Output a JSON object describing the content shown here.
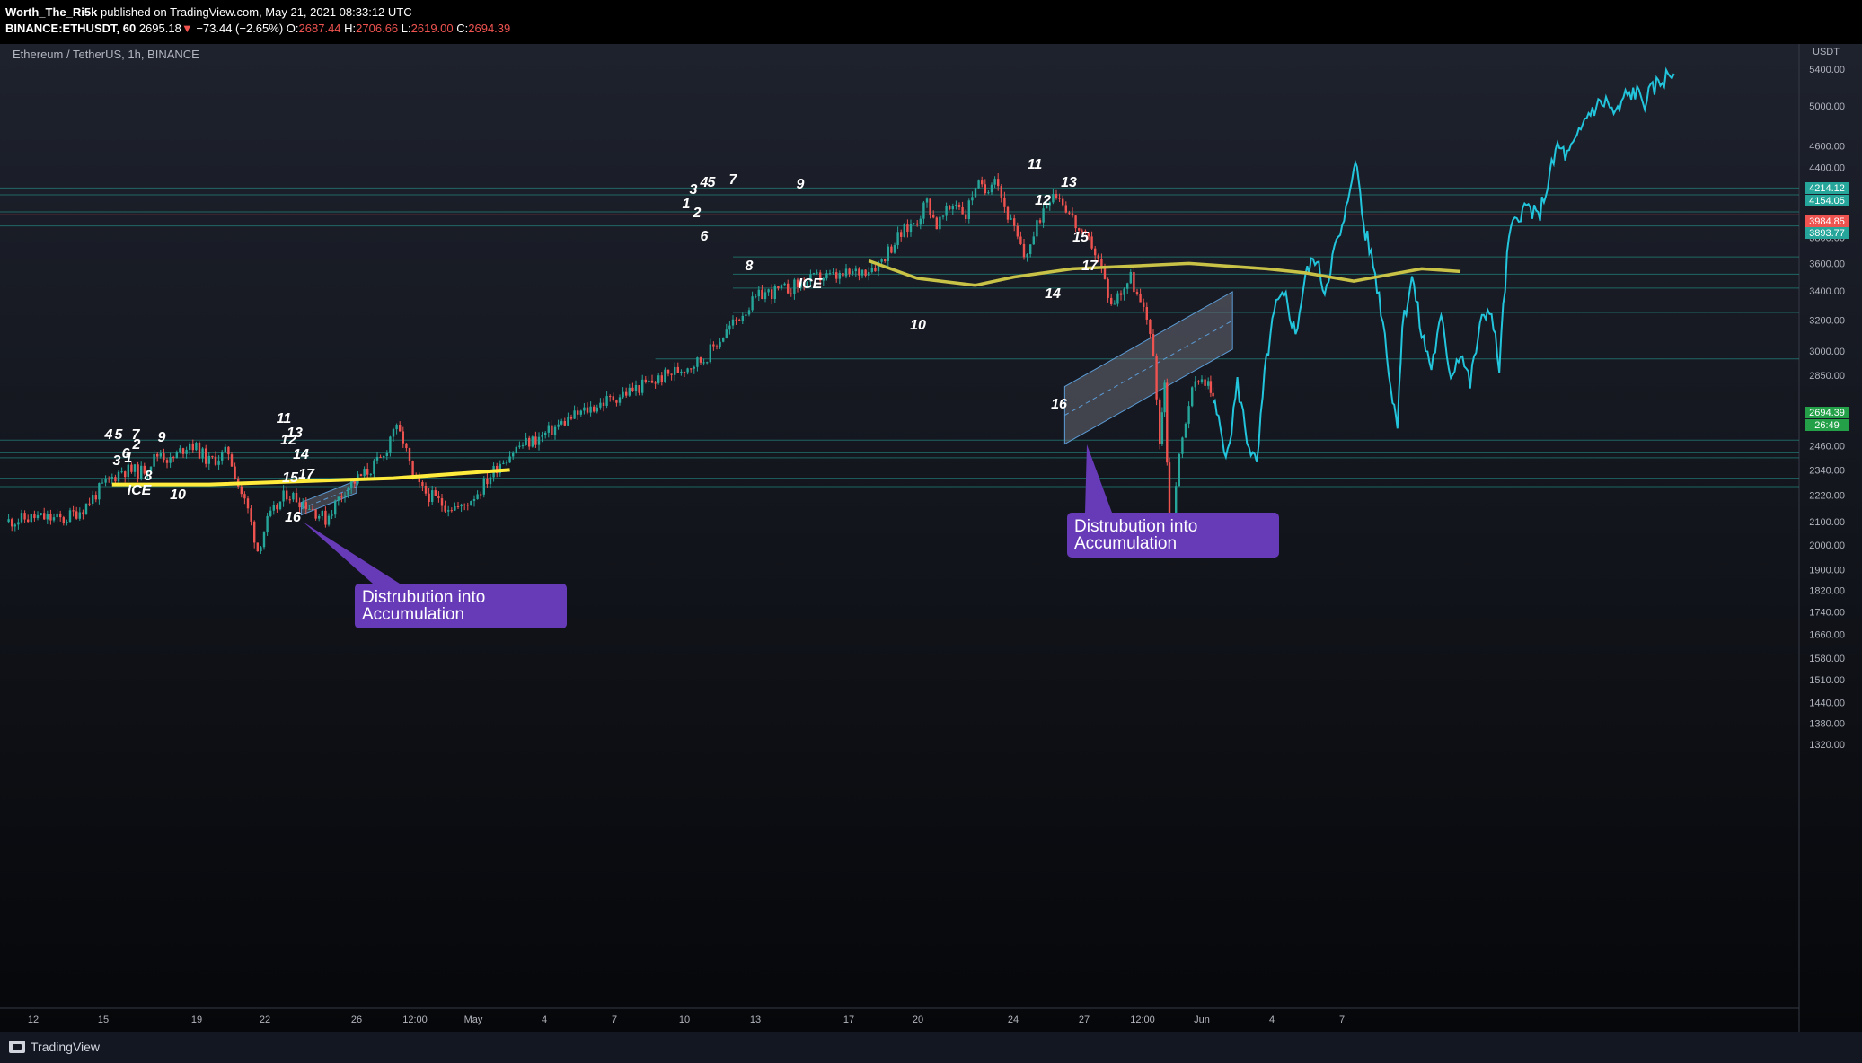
{
  "header": {
    "author": "Worth_The_Ri5k",
    "published_text": "published on TradingView.com, May 21, 2021 08:33:12 UTC",
    "symbol": "BINANCE:ETHUSDT, 60",
    "last": "2695.18",
    "arrow": "▼",
    "change": "−73.44 (−2.65%)",
    "open_label": "O:",
    "open": "2687.44",
    "high_label": "H:",
    "high": "2706.66",
    "low_label": "L:",
    "low": "2619.00",
    "close_label": "C:",
    "close": "2694.39"
  },
  "chart_title": "Ethereum / TetherUS, 1h, BINANCE",
  "footer": {
    "brand": "TradingView"
  },
  "colors": {
    "background": "#131722",
    "up": "#26a69a",
    "down": "#ef5350",
    "projection": "#22c5dc",
    "ice_line": "#e8e36a",
    "callout": "#673ab7",
    "price_tag": "#24a148"
  },
  "chart_data": {
    "type": "candlestick",
    "title": "Ethereum / TetherUS, 1h, BINANCE",
    "y_axis": {
      "unit": "USDT",
      "scale": "log",
      "ticks": [
        1320,
        1380,
        1440,
        1510,
        1580,
        1660,
        1740,
        1820,
        1900,
        2000,
        2100,
        2220,
        2340,
        2460,
        2580,
        2850,
        3000,
        3200,
        3400,
        3600,
        3800,
        4400,
        4600,
        5000,
        5400
      ],
      "tick_labels": [
        "1320.00",
        "1380.00",
        "1440.00",
        "1510.00",
        "1580.00",
        "1660.00",
        "1740.00",
        "1820.00",
        "1900.00",
        "2000.00",
        "2100.00",
        "2220.00",
        "2340.00",
        "2460.00",
        "2580.00",
        "2850.00",
        "3000.00",
        "3200.00",
        "3400.00",
        "3600.00",
        "3800.00",
        "4400.00",
        "4600.00",
        "5000.00",
        "5400.00"
      ]
    },
    "x_axis": {
      "tick_labels": [
        "12",
        "15",
        "19",
        "22",
        "26",
        "12:00",
        "May",
        "4",
        "7",
        "10",
        "13",
        "17",
        "20",
        "24",
        "27",
        "12:00",
        "Jun",
        "4",
        "7"
      ]
    },
    "price_tags": [
      {
        "value": "4214.12",
        "color": "#26a69a"
      },
      {
        "value": "4154.05",
        "color": "#26a69a"
      },
      {
        "value": "3984.85",
        "color": "#ef5350"
      },
      {
        "value": "3893.77",
        "color": "#26a69a"
      },
      {
        "value": "2694.39",
        "color": "#24a148"
      },
      {
        "value": "26:49",
        "color": "#24a148"
      }
    ],
    "series": [
      {
        "style": "candles",
        "points": [
          [
            0,
            2100
          ],
          [
            3,
            2120
          ],
          [
            6,
            2110
          ],
          [
            8,
            2160
          ],
          [
            10,
            2260
          ],
          [
            12,
            2340
          ],
          [
            14,
            2330
          ],
          [
            16,
            2430
          ],
          [
            17,
            2380
          ],
          [
            19,
            2480
          ],
          [
            21,
            2380
          ],
          [
            23,
            2430
          ],
          [
            24,
            2270
          ],
          [
            25,
            2150
          ],
          [
            26,
            1980
          ],
          [
            27,
            2100
          ],
          [
            29,
            2230
          ],
          [
            31,
            2180
          ],
          [
            33,
            2110
          ],
          [
            35,
            2250
          ],
          [
            37,
            2320
          ],
          [
            39,
            2400
          ],
          [
            40,
            2560
          ],
          [
            41,
            2490
          ],
          [
            42,
            2300
          ],
          [
            43,
            2240
          ],
          [
            45,
            2180
          ],
          [
            47,
            2160
          ],
          [
            49,
            2250
          ],
          [
            51,
            2380
          ],
          [
            53,
            2460
          ],
          [
            55,
            2500
          ],
          [
            58,
            2600
          ],
          [
            61,
            2680
          ],
          [
            64,
            2750
          ],
          [
            67,
            2820
          ],
          [
            70,
            2900
          ],
          [
            72,
            2950
          ],
          [
            74,
            3100
          ],
          [
            76,
            3250
          ],
          [
            78,
            3380
          ],
          [
            80,
            3400
          ],
          [
            82,
            3450
          ],
          [
            84,
            3500
          ],
          [
            86,
            3500
          ],
          [
            88,
            3540
          ],
          [
            90,
            3600
          ],
          [
            92,
            3800
          ],
          [
            94,
            3950
          ],
          [
            95,
            4100
          ],
          [
            96,
            3900
          ],
          [
            98,
            4100
          ],
          [
            99,
            3980
          ],
          [
            100,
            4250
          ],
          [
            101,
            4180
          ],
          [
            102,
            4350
          ],
          [
            103,
            4050
          ],
          [
            104,
            3850
          ],
          [
            105,
            3650
          ],
          [
            106,
            3800
          ],
          [
            107,
            4050
          ],
          [
            108,
            4200
          ],
          [
            109,
            4100
          ],
          [
            110,
            3950
          ],
          [
            111,
            3800
          ],
          [
            112,
            3750
          ],
          [
            113,
            3550
          ],
          [
            114,
            3300
          ],
          [
            115,
            3400
          ],
          [
            116,
            3500
          ],
          [
            117,
            3300
          ],
          [
            118,
            3150
          ],
          [
            119,
            2500
          ],
          [
            119.5,
            2800
          ],
          [
            120,
            2000
          ],
          [
            121,
            2400
          ],
          [
            122,
            2700
          ],
          [
            123,
            2850
          ],
          [
            124,
            2800
          ],
          [
            124.5,
            2700
          ]
        ]
      },
      {
        "style": "projection",
        "points": [
          [
            124.5,
            2700
          ],
          [
            126,
            2400
          ],
          [
            127,
            2800
          ],
          [
            128,
            2500
          ],
          [
            129,
            2350
          ],
          [
            130,
            2950
          ],
          [
            131,
            3300
          ],
          [
            132,
            3350
          ],
          [
            133,
            3100
          ],
          [
            134,
            3500
          ],
          [
            135,
            3650
          ],
          [
            136,
            3400
          ],
          [
            137,
            3700
          ],
          [
            138,
            3900
          ],
          [
            139,
            4450
          ],
          [
            139.5,
            4300
          ],
          [
            140,
            3900
          ],
          [
            141,
            3600
          ],
          [
            142,
            3200
          ],
          [
            143,
            2700
          ],
          [
            143.5,
            2600
          ],
          [
            144,
            3150
          ],
          [
            145,
            3500
          ],
          [
            146,
            3100
          ],
          [
            147,
            2900
          ],
          [
            148,
            3200
          ],
          [
            149,
            2850
          ],
          [
            150,
            3000
          ],
          [
            151,
            2800
          ],
          [
            152,
            3150
          ],
          [
            153,
            3300
          ],
          [
            154,
            2900
          ],
          [
            155,
            3800
          ],
          [
            156,
            4000
          ],
          [
            157,
            4050
          ],
          [
            158,
            3950
          ],
          [
            159,
            4250
          ],
          [
            160,
            4600
          ],
          [
            161,
            4500
          ],
          [
            162,
            4650
          ],
          [
            163,
            4900
          ],
          [
            164,
            5000
          ],
          [
            165,
            5050
          ],
          [
            166,
            4900
          ],
          [
            167,
            5100
          ],
          [
            168,
            5150
          ],
          [
            169,
            5050
          ],
          [
            170,
            5200
          ],
          [
            171,
            5300
          ],
          [
            172,
            5350
          ]
        ]
      }
    ],
    "ice_lines": [
      {
        "label": "ICE",
        "points": [
          [
            11,
            2270
          ],
          [
            21,
            2270
          ],
          [
            40,
            2300
          ],
          [
            52,
            2340
          ]
        ]
      },
      {
        "label": "ICE",
        "points": [
          [
            89,
            3620
          ],
          [
            94,
            3490
          ],
          [
            100,
            3440
          ],
          [
            104,
            3500
          ],
          [
            110,
            3560
          ],
          [
            116,
            3580
          ],
          [
            122,
            3600
          ],
          [
            130,
            3560
          ],
          [
            134,
            3530
          ],
          [
            139,
            3470
          ],
          [
            146,
            3560
          ],
          [
            150,
            3540
          ]
        ]
      }
    ],
    "wave_labels": {
      "cycle_1": [
        "1",
        "2",
        "3",
        "4",
        "5",
        "6",
        "7",
        "8",
        "9",
        "ICE",
        "10",
        "11",
        "12",
        "13",
        "14",
        "15",
        "16",
        "17"
      ],
      "cycle_2": [
        "1",
        "2",
        "3",
        "4",
        "5",
        "6",
        "7",
        "8",
        "9",
        "ICE",
        "10",
        "11",
        "12",
        "13",
        "14",
        "15",
        "16",
        "17"
      ]
    },
    "annotations": [
      {
        "text_line1": "Distrubution into",
        "text_line2": "Accumulation"
      },
      {
        "text_line1": "Distrubution into",
        "text_line2": "Accumulation"
      }
    ]
  }
}
